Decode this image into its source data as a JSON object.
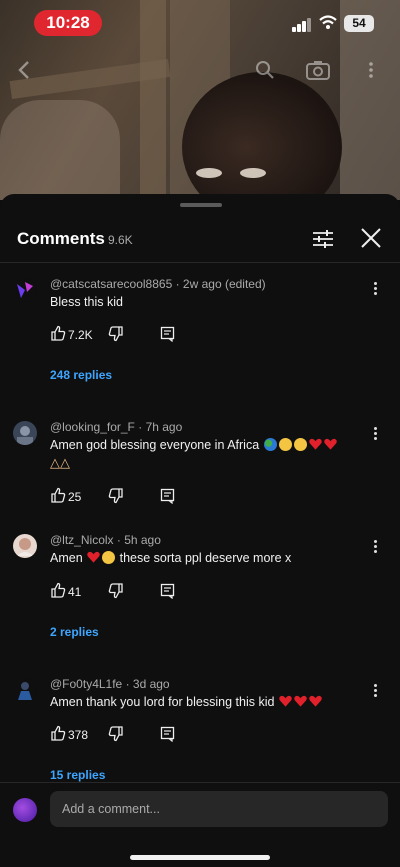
{
  "status_bar": {
    "time": "10:28",
    "battery": "54"
  },
  "comments_header": {
    "title": "Comments",
    "count": "9.6K"
  },
  "comments": [
    {
      "author": "@catscatsarecool8865",
      "age": "2w ago (edited)",
      "text": "Bless this kid",
      "likes": "7.2K",
      "replies": "248 replies",
      "avatar_color": "#6a3df0"
    },
    {
      "author": "@looking_for_F",
      "age": "7h ago",
      "text": "Amen god blessing everyone in Africa",
      "likes": "25",
      "replies": "",
      "avatar_color": "#3a4658"
    },
    {
      "author": "@ltz_Nicolx",
      "age": "5h ago",
      "text_before": "Amen",
      "text_after": "these sorta ppl deserve more x",
      "likes": "41",
      "replies": "2 replies",
      "avatar_color": "#e8d8d0"
    },
    {
      "author": "@Fo0ty4L1fe",
      "age": "3d ago",
      "text": "Amen thank you lord for blessing this kid",
      "likes": "378",
      "replies": "15 replies",
      "avatar_color": "#2a3a55"
    }
  ],
  "add_comment": {
    "placeholder": "Add a comment..."
  },
  "colors": {
    "accent_link": "#3ea6ff",
    "background": "#0f0f0f",
    "time_pill": "#e0262f"
  }
}
